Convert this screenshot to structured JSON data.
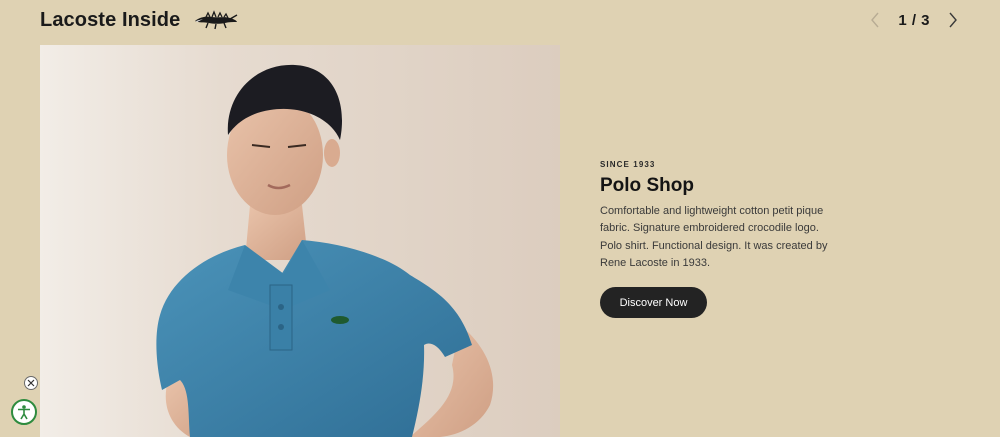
{
  "header": {
    "title": "Lacoste Inside",
    "logo_icon": "crocodile-logo-icon"
  },
  "pager": {
    "counter": "1 / 3",
    "prev_icon": "chevron-left-icon",
    "next_icon": "chevron-right-icon"
  },
  "hero": {
    "image": "model-in-blue-polo-shirt"
  },
  "promo": {
    "eyebrow": "SINCE 1933",
    "title": "Polo Shop",
    "description": "Comfortable and lightweight cotton petit pique fabric. Signature embroidered crocodile logo. Polo shirt. Functional design. It was created by Rene Lacoste in 1933.",
    "cta_label": "Discover Now"
  },
  "widgets": {
    "close_icon": "close-icon",
    "accessibility_icon": "accessibility-icon"
  },
  "colors": {
    "background": "#dfd2b3",
    "cta_background": "#232323",
    "polo_blue": "#3f86ad"
  }
}
